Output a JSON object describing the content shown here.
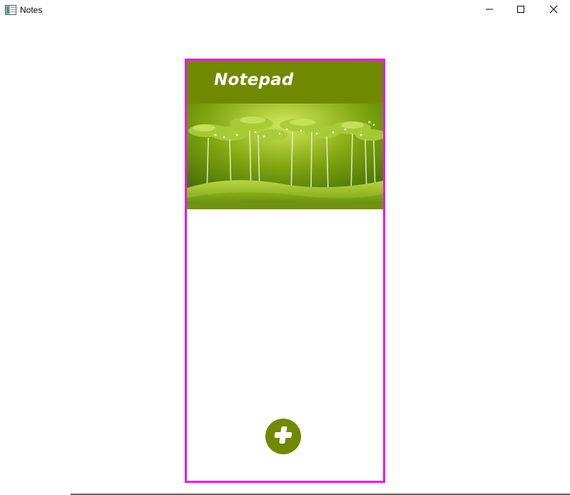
{
  "window": {
    "title": "Notes",
    "controls": {
      "minimize": "minimize-icon",
      "maximize": "maximize-icon",
      "close": "close-icon"
    }
  },
  "app": {
    "title": "Notepad",
    "banner_image": "forest-illustration",
    "fab_icon": "plus-icon",
    "colors": {
      "accent": "#6f8a00",
      "frame": "#ee11ee",
      "background": "#ffffff"
    }
  }
}
